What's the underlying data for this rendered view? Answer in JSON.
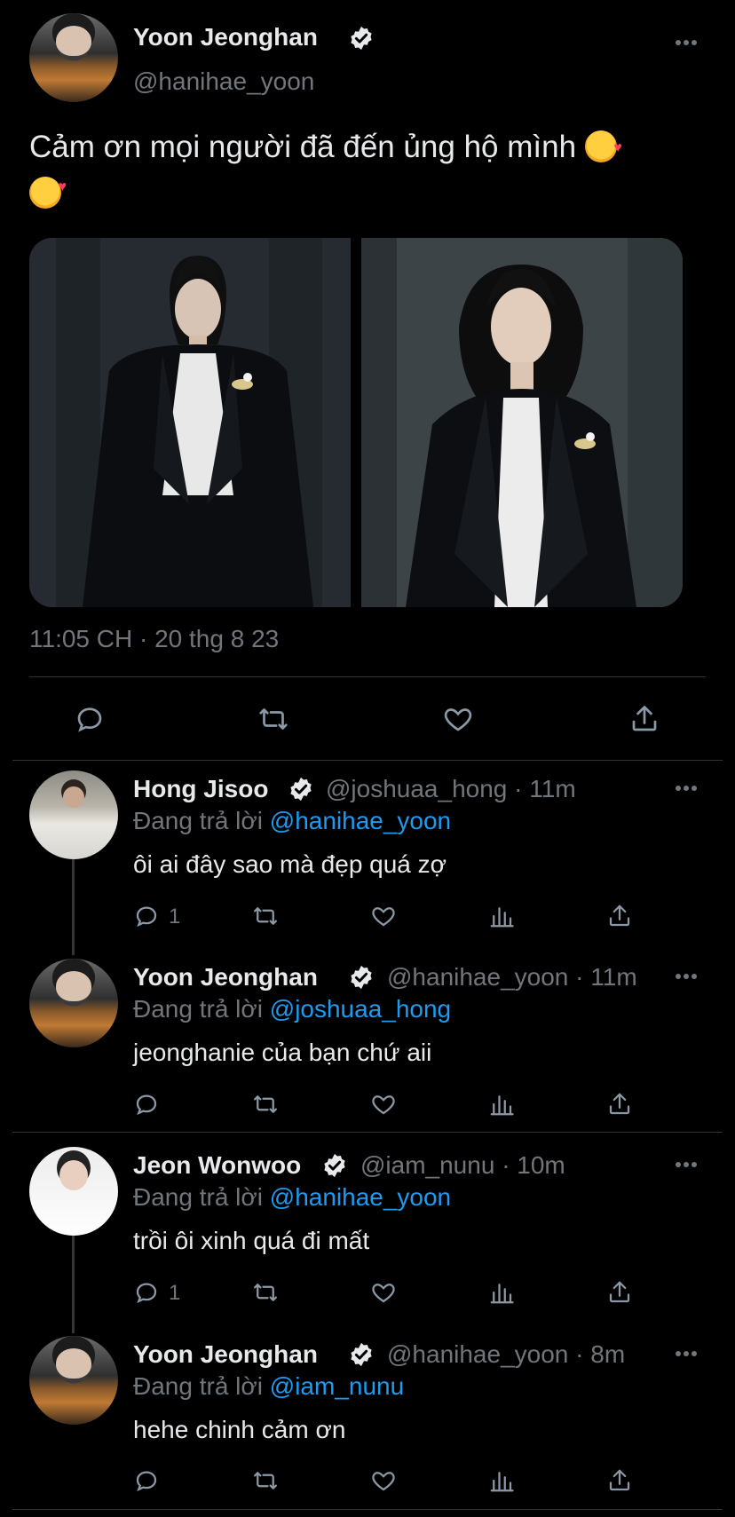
{
  "main_tweet": {
    "author_name": "Yoon Jeonghan",
    "author_handle": "@hanihae_yoon",
    "text": "Cảm ơn mọi người đã đến ủng hộ mình",
    "emojis": [
      "smiling-face-with-hearts",
      "face-blowing-kiss"
    ],
    "timestamp": "11:05 CH · 20 thg 8 23",
    "actions": [
      "reply-icon",
      "retweet-icon",
      "like-icon",
      "share-icon"
    ]
  },
  "replies": [
    {
      "author_name": "Hong Jisoo",
      "author_handle": "@joshuaa_hong",
      "time": "· 11m",
      "replying_prefix": "Đang trả lời",
      "replying_to": "@hanihae_yoon",
      "text": "ôi ai đây sao mà đẹp quá zợ",
      "reply_count": "1"
    },
    {
      "author_name": "Yoon Jeonghan",
      "author_handle": "@hanihae_yoon",
      "time": "· 11m",
      "replying_prefix": "Đang trả lời",
      "replying_to": "@joshuaa_hong",
      "text": "jeonghanie của bạn chứ aii",
      "reply_count": ""
    },
    {
      "author_name": "Jeon Wonwoo",
      "author_handle": "@iam_nunu",
      "time": "· 10m",
      "replying_prefix": "Đang trả lời",
      "replying_to": "@hanihae_yoon",
      "text": "trồi ôi xinh quá đi mất",
      "reply_count": "1"
    },
    {
      "author_name": "Yoon Jeonghan",
      "author_handle": "@hanihae_yoon",
      "time": "· 8m",
      "replying_prefix": "Đang trả lời",
      "replying_to": "@iam_nunu",
      "text": "hehe chinh cảm ơn",
      "reply_count": ""
    }
  ],
  "colors": {
    "background": "#000000",
    "text_primary": "#e7e9ea",
    "text_secondary": "#71767b",
    "link": "#1d9bf0",
    "divider": "#2f3336"
  }
}
